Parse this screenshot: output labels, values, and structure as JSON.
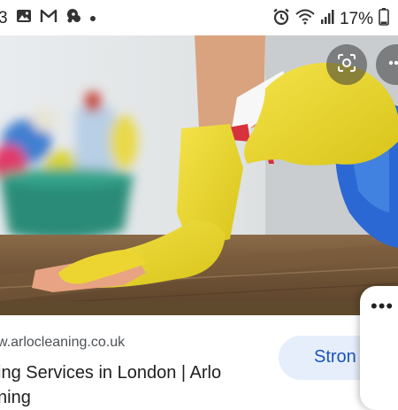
{
  "status_bar": {
    "time": "3",
    "battery_percent": "17%",
    "battery_level": 0.17,
    "notification_icons": [
      "gallery-icon",
      "gmail-icon",
      "app-notification-icon",
      "more-notifications-dot-icon"
    ],
    "system_icons": [
      "alarm-icon",
      "wifi-icon",
      "signal-icon",
      "battery-icon"
    ]
  },
  "image_overlay": {
    "lens_icon": "google-lens-icon",
    "more_icon": "more-options-icon"
  },
  "result": {
    "url": "w.arlocleaning.co.uk",
    "title_line1": "ing Services in London | Arlo",
    "title_line2": "ning",
    "chip_label": "Stron",
    "side_menu_icon": "more-horizontal-icon",
    "side_menu_label": "•••"
  },
  "colors": {
    "chip_bg": "#e6eefb",
    "chip_text": "#1a55b8",
    "url_text": "#4d5156",
    "title_text": "#1f1f1f"
  }
}
